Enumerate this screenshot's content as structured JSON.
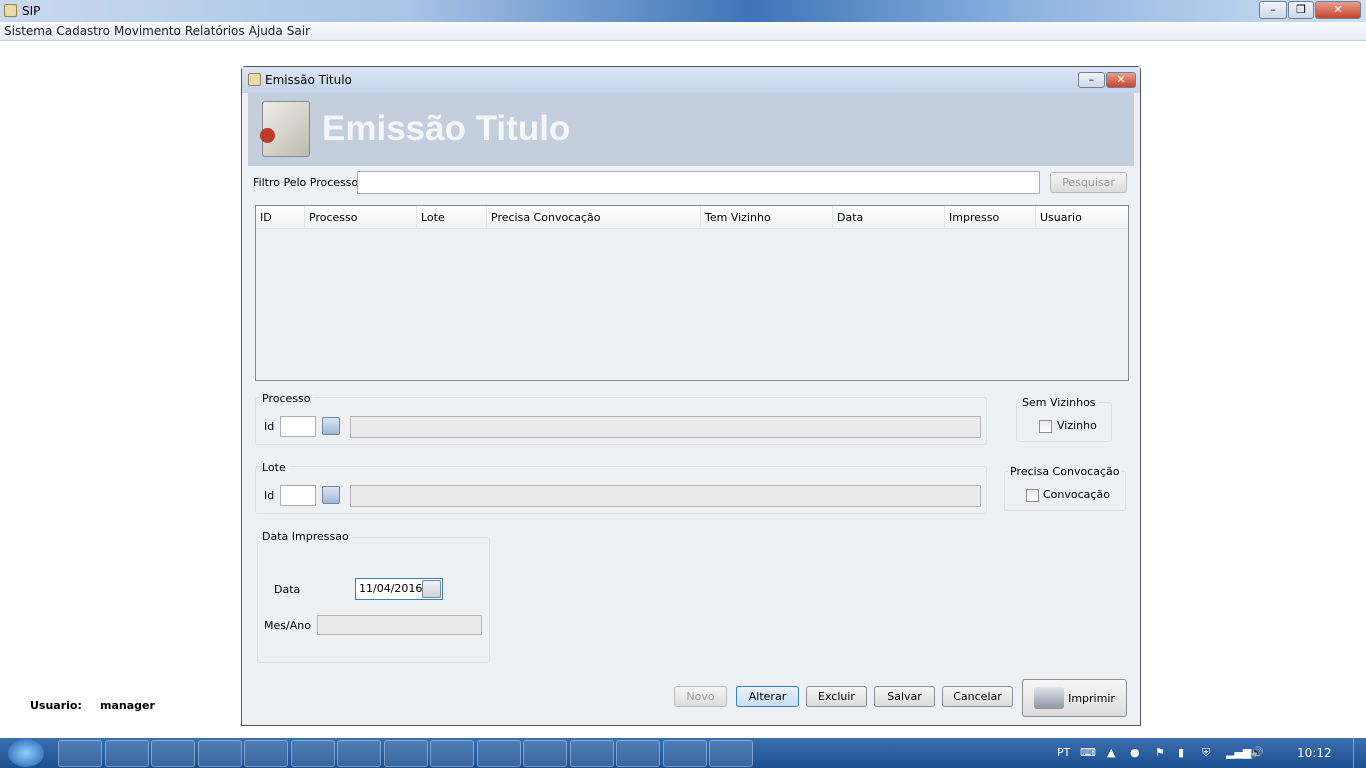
{
  "app": {
    "title": "SIP",
    "window_controls": [
      "minimize",
      "restore",
      "close"
    ]
  },
  "menu": [
    "Sistema",
    "Cadastro",
    "Movimento",
    "Relatórios",
    "Ajuda",
    "Sair"
  ],
  "dialog": {
    "title": "Emissão Titulo",
    "banner_title": "Emissão Titulo",
    "filter": {
      "label": "Filtro Pelo Processo",
      "value": "",
      "search_button": "Pesquisar"
    },
    "table": {
      "columns": [
        "ID",
        "Processo",
        "Lote",
        "Precisa Convocação",
        "Tem Vizinho",
        "Data",
        "Impresso",
        "Usuario"
      ],
      "rows": []
    },
    "processo": {
      "legend": "Processo",
      "id_label": "Id",
      "id_value": "",
      "description": ""
    },
    "lote": {
      "legend": "Lote",
      "id_label": "Id",
      "id_value": "",
      "description": ""
    },
    "sem_vizinhos": {
      "legend": "Sem Vizinhos",
      "checkbox_label": "Vizinho",
      "checked": false
    },
    "precisa_convocacao": {
      "legend": "Precisa Convocação",
      "checkbox_label": "Convocação",
      "checked": false
    },
    "data_impressao": {
      "legend": "Data Impressao",
      "data_label": "Data",
      "data_value": "11/04/2016",
      "mes_ano_label": "Mes/Ano",
      "mes_ano_value": ""
    },
    "buttons": {
      "novo": "Novo",
      "alterar": "Alterar",
      "excluir": "Excluir",
      "salvar": "Salvar",
      "cancelar": "Cancelar",
      "imprimir": "Imprimir"
    }
  },
  "status": {
    "user_label": "Usuario:",
    "user_value": "manager"
  },
  "taskbar": {
    "apps": [
      "ie",
      "explorer",
      "app",
      "app",
      "app",
      "app",
      "excel",
      "calculator",
      "app",
      "word",
      "chrome",
      "app",
      "skype",
      "app",
      "java"
    ],
    "lang": "PT",
    "clock": "10:12"
  }
}
